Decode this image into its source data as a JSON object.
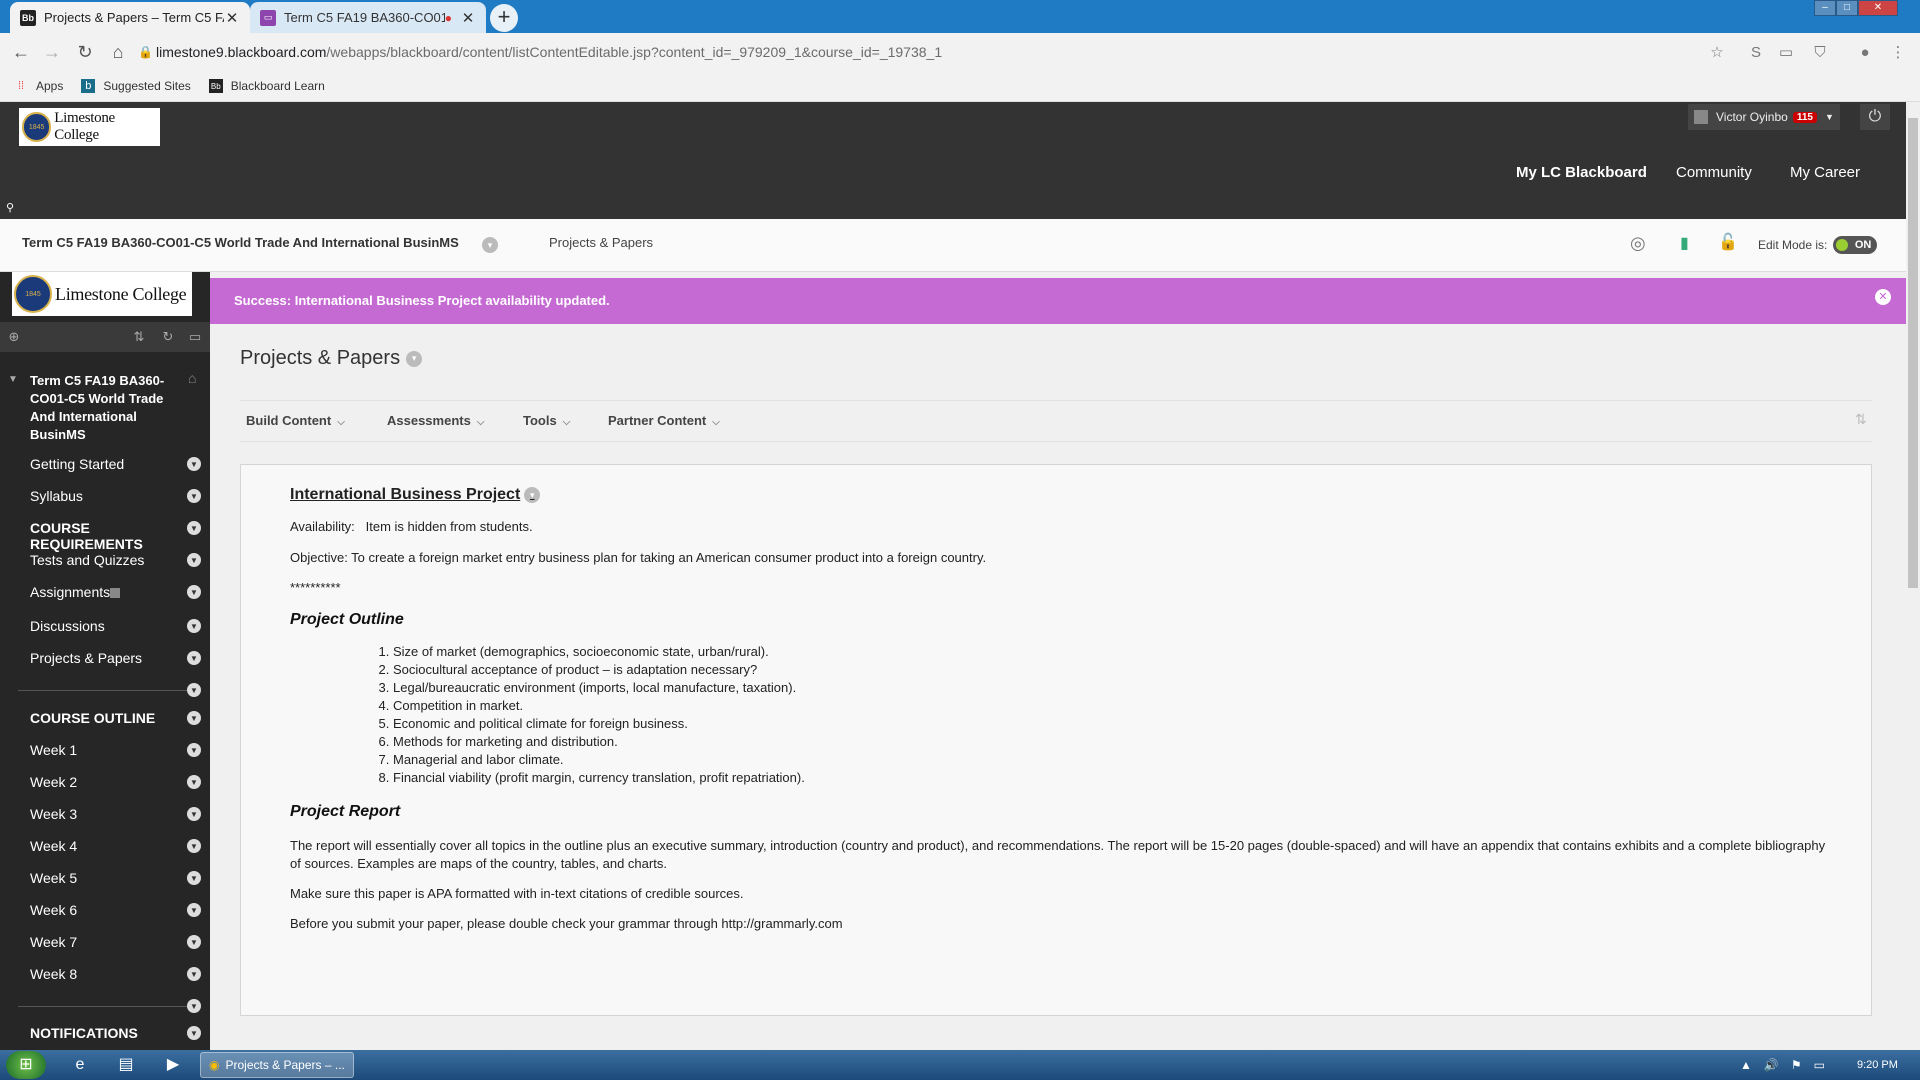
{
  "browser": {
    "tabs": [
      {
        "title": "Projects & Papers – Term C5 FA1",
        "favicon": "Bb",
        "active": true
      },
      {
        "title": "Term C5 FA19 BA360-CO01-",
        "favicon": "purple-doc-icon",
        "active": false
      }
    ],
    "url_host": "limestone9.blackboard.com",
    "url_path": "/webapps/blackboard/content/listContentEditable.jsp?content_id=_979209_1&course_id=_19738_1",
    "bookmarks": [
      {
        "label": "Apps",
        "icon": "apps-grid-icon"
      },
      {
        "label": "Suggested Sites",
        "icon": "bing-icon"
      },
      {
        "label": "Blackboard Learn",
        "icon": "bb-icon"
      }
    ]
  },
  "header": {
    "logo_text": "Limestone College",
    "user_name": "Victor Oyinbo",
    "notification_count": "115",
    "nav": [
      "My LC Blackboard",
      "Community",
      "My Career"
    ]
  },
  "course_bar": {
    "course_title": "Term C5 FA19 BA360-CO01-C5 World Trade And International BusinMS",
    "breadcrumb": "Projects & Papers",
    "edit_mode_label": "Edit Mode is:",
    "edit_mode_value": "ON"
  },
  "sidebar": {
    "logo_text": "Limestone College",
    "course_title": "Term C5 FA19 BA360-CO01-C5 World Trade And International BusinMS",
    "items": [
      {
        "label": "Getting Started"
      },
      {
        "label": "Syllabus"
      },
      {
        "label": "COURSE REQUIREMENTS"
      },
      {
        "label": "Tests and Quizzes"
      },
      {
        "label": "Assignments"
      },
      {
        "label": "Discussions"
      },
      {
        "label": "Projects & Papers"
      },
      {
        "label": "COURSE OUTLINE"
      },
      {
        "label": "Week 1"
      },
      {
        "label": "Week 2"
      },
      {
        "label": "Week 3"
      },
      {
        "label": "Week 4"
      },
      {
        "label": "Week 5"
      },
      {
        "label": "Week 6"
      },
      {
        "label": "Week 7"
      },
      {
        "label": "Week 8"
      },
      {
        "label": "NOTIFICATIONS"
      }
    ]
  },
  "content": {
    "success_message": "Success: International Business Project availability updated.",
    "page_title": "Projects & Papers",
    "actions": [
      "Build Content",
      "Assessments",
      "Tools",
      "Partner Content"
    ],
    "item": {
      "title": "International Business Project",
      "availability_label": "Availability:",
      "availability_value": "Item is hidden from students.",
      "objective": "Objective: To create a foreign market entry business plan for taking an American consumer product into a foreign country.",
      "separator": "**********",
      "outline_heading": "Project Outline",
      "outline": [
        "Size of market (demographics, socioeconomic state, urban/rural).",
        "Sociocultural acceptance of product – is adaptation necessary?",
        "Legal/bureaucratic environment (imports, local manufacture, taxation).",
        "Competition in market.",
        "Economic and political climate for foreign business.",
        "Methods for marketing and distribution.",
        "Managerial and labor climate.",
        "Financial viability (profit margin, currency translation, profit repatriation)."
      ],
      "report_heading": "Project Report",
      "report_p1": "The report will essentially cover all topics in the outline plus an executive summary, introduction (country and product), and recommendations. The report will be 15-20 pages (double-spaced) and will have an appendix that contains exhibits and a complete bibliography of sources. Examples are maps of the country, tables, and charts.",
      "report_p2": "Make sure this paper is APA formatted with in-text citations of credible sources.",
      "report_p3": "Before you submit your paper, please double check your grammar through http://grammarly.com"
    }
  },
  "taskbar": {
    "active_window": "Projects & Papers – ...",
    "clock": "9:20 PM"
  },
  "colors": {
    "success_bar": "#c56ad3",
    "header_bg": "#333333",
    "sidebar_bg": "#262626",
    "chrome_blue": "#1e7bc4"
  }
}
